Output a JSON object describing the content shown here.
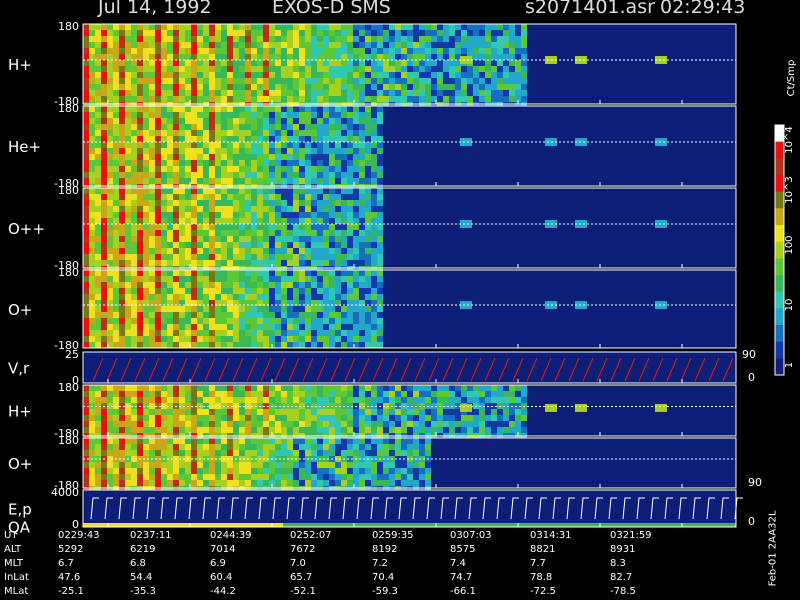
{
  "header": {
    "date": "Jul 14, 1992",
    "instrument": "EXOS-D SMS",
    "file": "s2071401.asr",
    "time": "02:29:43"
  },
  "colorbar": {
    "unit": "Ct/Smp",
    "ticks": [
      "10^4",
      "10^3",
      "100",
      "10",
      "1"
    ]
  },
  "side_label": "Feb-01 2AA32L",
  "panels": [
    {
      "label": "H+",
      "top": "180",
      "bottom": "-180"
    },
    {
      "label": "He+",
      "top": "180",
      "bottom": "-180"
    },
    {
      "label": "O++",
      "top": "180",
      "bottom": "-180"
    },
    {
      "label": "O+",
      "top": "180",
      "bottom": "-180"
    },
    {
      "label": "V,r",
      "top": "25",
      "bottom": "0",
      "right_top": "90",
      "right_bottom": "0"
    },
    {
      "label": "H+",
      "top": "180",
      "bottom": "-180"
    },
    {
      "label": "O+",
      "top": "180",
      "bottom": "-180",
      "right_bottom": "90"
    },
    {
      "label": "E,p",
      "label2": "QA",
      "top": "4000",
      "bottom": "0",
      "right_bottom": "0"
    }
  ],
  "table": {
    "rows": [
      {
        "name": "UT",
        "values": [
          "0229:43",
          "0237:11",
          "0244:39",
          "0252:07",
          "0259:35",
          "0307:03",
          "0314:31",
          "0321:59"
        ]
      },
      {
        "name": "ALT",
        "values": [
          "5292",
          "6219",
          "7014",
          "7672",
          "8192",
          "8575",
          "8821",
          "8931"
        ]
      },
      {
        "name": "MLT",
        "values": [
          "6.7",
          "6.8",
          "6.9",
          "7.0",
          "7.2",
          "7.4",
          "7.7",
          "8.3"
        ]
      },
      {
        "name": "InLat",
        "values": [
          "47.6",
          "54.4",
          "60.4",
          "65.7",
          "70.4",
          "74.7",
          "78.8",
          "82.7"
        ]
      },
      {
        "name": "MLat",
        "values": [
          "-25.1",
          "-35.3",
          "-44.2",
          "-52.1",
          "-59.3",
          "-66.1",
          "-72.5",
          "-78.5"
        ]
      }
    ]
  },
  "chart_data": {
    "type": "heatmap",
    "title": "Jul 14, 1992 EXOS-D SMS",
    "x_label": "UT",
    "x_ticks": [
      "0229:43",
      "0237:11",
      "0244:39",
      "0252:07",
      "0259:35",
      "0307:03",
      "0314:31",
      "0321:59"
    ],
    "colorscale": {
      "unit": "Ct/Smp",
      "scale": "log",
      "range": [
        1,
        10000
      ]
    },
    "series": [
      {
        "name": "H+",
        "ylim": [
          -180,
          180
        ]
      },
      {
        "name": "He+",
        "ylim": [
          -180,
          180
        ]
      },
      {
        "name": "O++",
        "ylim": [
          -180,
          180
        ]
      },
      {
        "name": "O+",
        "ylim": [
          -180,
          180
        ]
      },
      {
        "name": "V,r",
        "ylim": [
          0,
          25
        ],
        "ylim_right": [
          0,
          90
        ]
      },
      {
        "name": "H+",
        "ylim": [
          -180,
          180
        ]
      },
      {
        "name": "O+",
        "ylim": [
          -180,
          180
        ]
      },
      {
        "name": "E,p",
        "ylim": [
          0,
          4000
        ]
      }
    ]
  }
}
